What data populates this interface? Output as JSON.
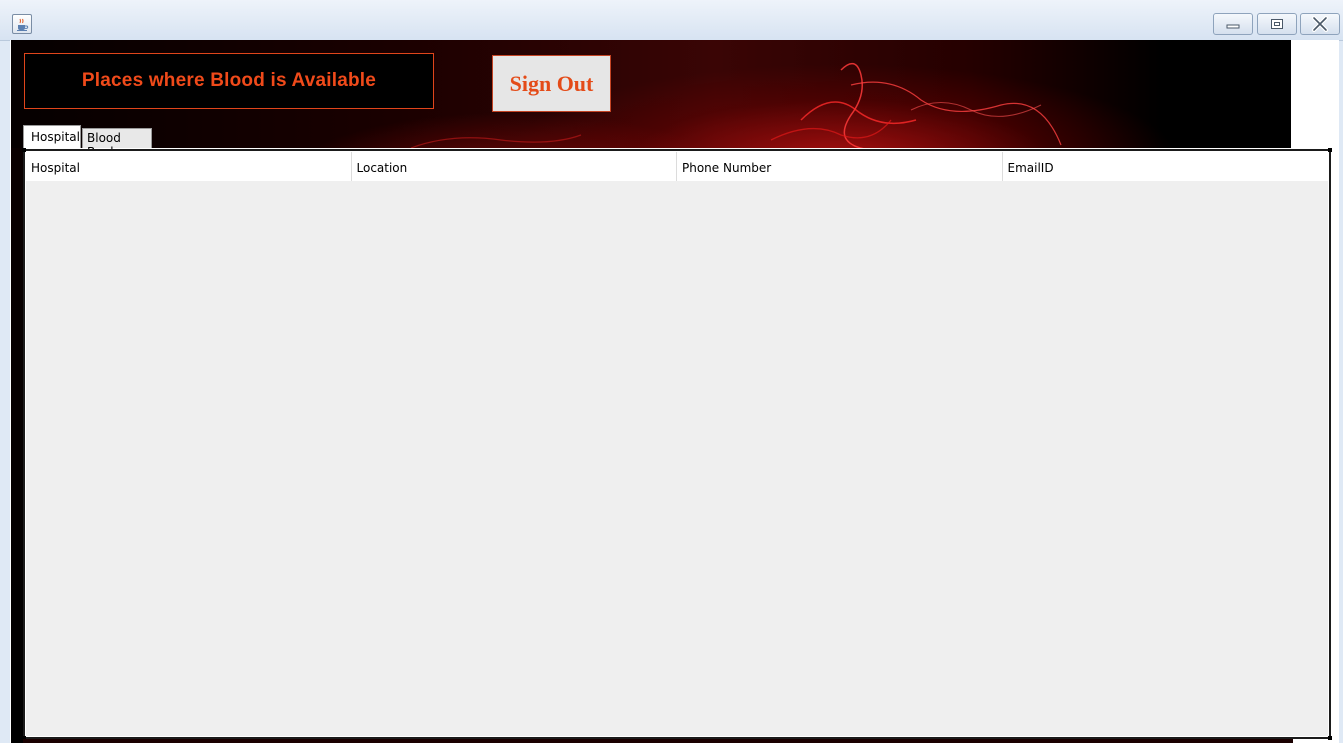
{
  "window": {
    "title": "",
    "icon": "java-cup-icon",
    "controls": [
      "minimize-icon",
      "maximize-icon",
      "close-icon"
    ]
  },
  "header": {
    "heading": "Places where Blood is Available",
    "signout_label": "Sign Out"
  },
  "tabs": [
    {
      "label": "Hospital",
      "selected": true
    },
    {
      "label": "Blood Bank",
      "selected": false
    }
  ],
  "table": {
    "columns": [
      "Hospital",
      "Location",
      "Phone Number",
      "EmailID"
    ],
    "rows": []
  },
  "colors": {
    "accent_text": "#f04a1a",
    "banner_background": "#000000",
    "table_background": "#efefef"
  }
}
